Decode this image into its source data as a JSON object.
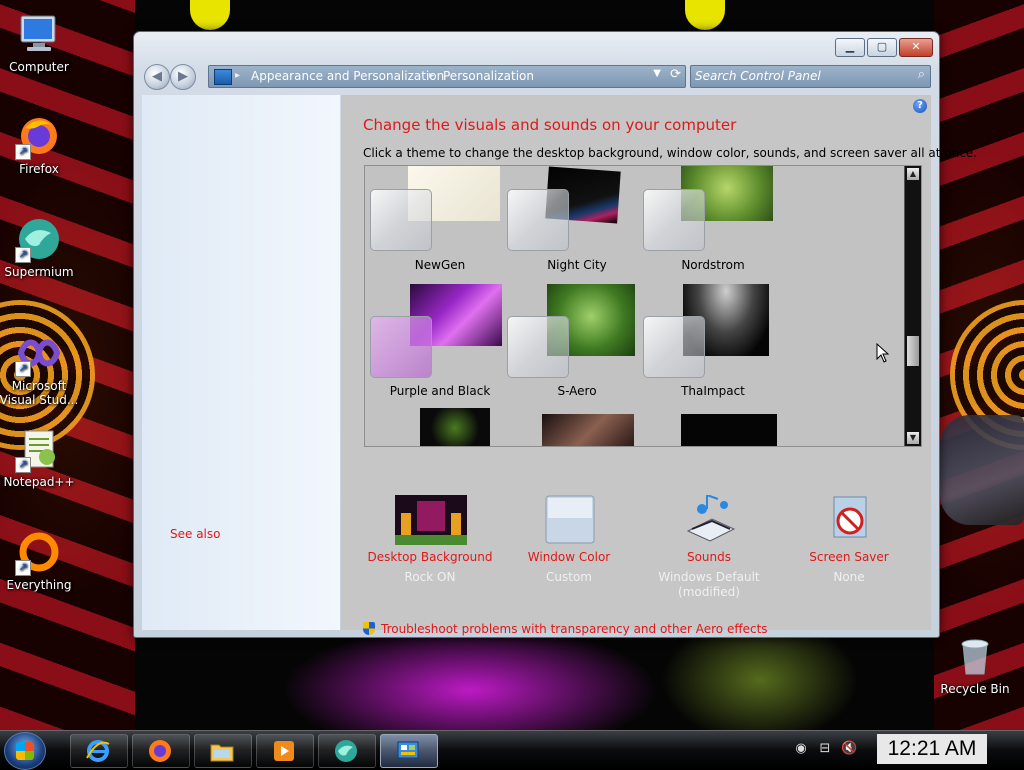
{
  "desktop": {
    "icons": [
      {
        "label": "Computer",
        "icon": "computer-icon"
      },
      {
        "label": "Firefox",
        "icon": "firefox-icon"
      },
      {
        "label": "Supermium",
        "icon": "supermium-icon"
      },
      {
        "label": "Microsoft Visual Stud...",
        "icon": "visual-studio-icon"
      },
      {
        "label": "Notepad++",
        "icon": "notepadpp-icon"
      },
      {
        "label": "Everything",
        "icon": "everything-icon"
      },
      {
        "label": "Recycle Bin",
        "icon": "recycle-bin-icon"
      }
    ]
  },
  "window": {
    "address": {
      "crumbs": [
        "Appearance and Personalization",
        "Personalization"
      ]
    },
    "search_placeholder": "Search Control Panel",
    "left_pane": {
      "see_also": "See also"
    },
    "content": {
      "heading": "Change the visuals and sounds on your computer",
      "description": "Click a theme to change the desktop background, window color, sounds, and screen saver all at once.",
      "themes": [
        {
          "name": "NewGen"
        },
        {
          "name": "Night City"
        },
        {
          "name": "Nordstrom"
        },
        {
          "name": "Purple and Black"
        },
        {
          "name": "S-Aero"
        },
        {
          "name": "ThaImpact"
        }
      ],
      "customize": [
        {
          "label": "Desktop Background",
          "value": "Rock ON",
          "icon": "desktop-background-icon"
        },
        {
          "label": "Window Color",
          "value": "Custom",
          "icon": "window-color-icon"
        },
        {
          "label": "Sounds",
          "value": "Windows Default (modified)",
          "icon": "sounds-icon"
        },
        {
          "label": "Screen Saver",
          "value": "None",
          "icon": "screen-saver-icon"
        }
      ],
      "troubleshoot": "Troubleshoot problems with transparency and other Aero effects"
    }
  },
  "taskbar": {
    "items": [
      "internet-explorer-icon",
      "firefox-icon",
      "file-explorer-icon",
      "media-player-icon",
      "supermium-icon",
      "control-panel-icon"
    ],
    "clock": "12:21 AM"
  },
  "colors": {
    "accent_red": "#e01818",
    "content_bg": "#c6c6c6"
  }
}
